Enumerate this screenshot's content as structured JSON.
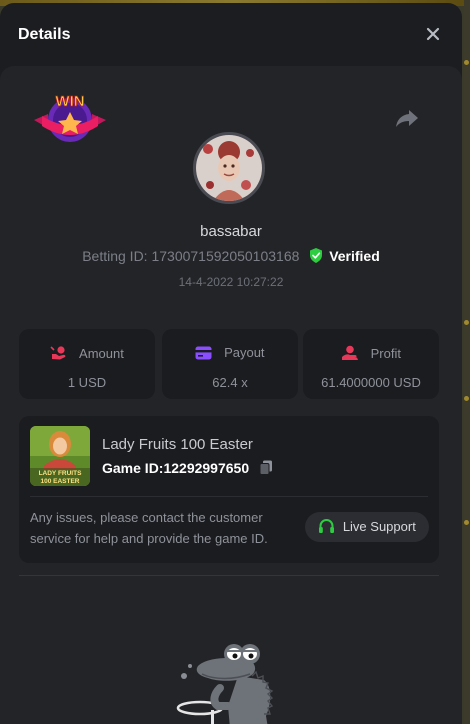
{
  "header": {
    "title": "Details",
    "close_icon": "close-icon"
  },
  "bet": {
    "badge_text": "WIN",
    "username": "bassabar",
    "betting_id_label": "Betting ID: 1730071592050103168",
    "verified_label": "Verified",
    "date": "14-4-2022 10:27:22"
  },
  "stats": {
    "amount": {
      "label": "Amount",
      "value": "1 USD",
      "icon": "money-bag-icon",
      "color": "#e8385a"
    },
    "payout": {
      "label": "Payout",
      "value": "62.4 x",
      "icon": "wallet-card-icon",
      "color": "#8a4dff"
    },
    "profit": {
      "label": "Profit",
      "value": "61.4000000 USD",
      "icon": "hand-coin-icon",
      "color": "#e8385a"
    }
  },
  "game": {
    "thumb_line1": "LADY FRUITS",
    "thumb_line2": "100 EASTER",
    "name": "Lady Fruits 100 Easter",
    "id_label": "Game ID:12292997650"
  },
  "support": {
    "text": "Any issues, please contact the customer service for help and provide the game ID.",
    "button_label": "Live Support",
    "accent": "#2ecc40"
  }
}
